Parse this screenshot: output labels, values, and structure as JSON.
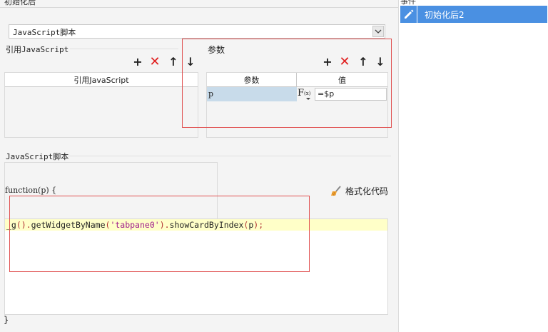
{
  "header": {
    "title": "初始化后"
  },
  "right_panel": {
    "title": "事件",
    "selected_item": {
      "label": "初始化后2",
      "icon": "pencil-icon"
    }
  },
  "script_type": {
    "selected": "JavaScript脚本"
  },
  "ref_js": {
    "title": "引用JavaScript",
    "column": "引用JavaScript",
    "toolbar": {
      "add": "+",
      "delete": "✕",
      "up": "↑",
      "down": "↓"
    }
  },
  "params": {
    "title": "参数",
    "columns": [
      "参数",
      "值"
    ],
    "rows": [
      {
        "name": "p",
        "fx": "F",
        "fx_sub": "(x)",
        "value": "=$p"
      }
    ],
    "toolbar": {
      "add": "+",
      "delete": "✕",
      "up": "↑",
      "down": "↓"
    }
  },
  "js_section": {
    "title": "JavaScript脚本",
    "function_sig": "function(p) {",
    "format_label": "格式化代码",
    "code": {
      "t1": "_g",
      "t2": "().",
      "t3": "getWidgetByName",
      "t4": "(",
      "t5": "'tabpane0'",
      "t6": ").",
      "t7": "showCardByIndex",
      "t8": "(",
      "t9": "p",
      "t10": ");"
    },
    "closing": "}"
  },
  "colors": {
    "accent": "#4a90e2",
    "delete": "#e02020",
    "highlight": "#ffffc8",
    "annotation": "#e05050"
  }
}
